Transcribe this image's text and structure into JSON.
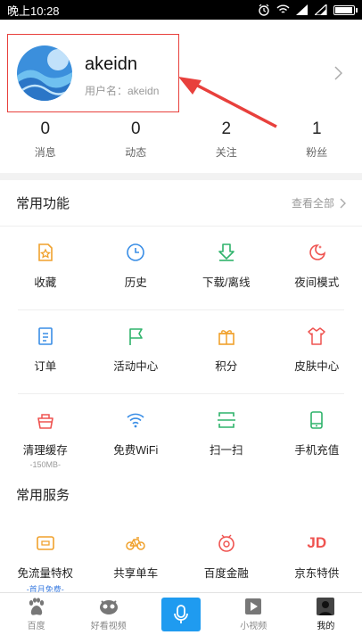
{
  "status_bar": {
    "time": "晚上10:28"
  },
  "profile": {
    "username": "akeidn",
    "user_id_line": "用户名：akeidn",
    "stats": [
      {
        "value": "0",
        "label": "消息"
      },
      {
        "value": "0",
        "label": "动态"
      },
      {
        "value": "2",
        "label": "关注"
      },
      {
        "value": "1",
        "label": "粉丝"
      }
    ]
  },
  "functions": {
    "title": "常用功能",
    "see_all": "查看全部",
    "items": [
      {
        "label": "收藏",
        "icon": "star-doc-icon",
        "color": "#f0a12c"
      },
      {
        "label": "历史",
        "icon": "clock-icon",
        "color": "#3a8ee6"
      },
      {
        "label": "下载/离线",
        "icon": "download-icon",
        "color": "#2fb36b"
      },
      {
        "label": "夜间模式",
        "icon": "moon-icon",
        "color": "#ef5350"
      },
      {
        "label": "订单",
        "icon": "order-icon",
        "color": "#3a8ee6"
      },
      {
        "label": "活动中心",
        "icon": "flag-icon",
        "color": "#2fb36b"
      },
      {
        "label": "积分",
        "icon": "gift-icon",
        "color": "#f0a12c"
      },
      {
        "label": "皮肤中心",
        "icon": "shirt-icon",
        "color": "#ef5350"
      },
      {
        "label": "清理缓存",
        "icon": "basket-icon",
        "color": "#ef5350",
        "sub": "-150MB-"
      },
      {
        "label": "免费WiFi",
        "icon": "wifi-icon",
        "color": "#3a8ee6"
      },
      {
        "label": "扫一扫",
        "icon": "scan-icon",
        "color": "#2fb36b"
      },
      {
        "label": "手机充值",
        "icon": "phone-icon",
        "color": "#2fb36b"
      }
    ]
  },
  "services": {
    "title": "常用服务",
    "items": [
      {
        "label": "免流量特权",
        "icon": "data-card-icon",
        "color": "#f0a12c",
        "sub": "-首月免费-"
      },
      {
        "label": "共享单车",
        "icon": "bike-icon",
        "color": "#f0a12c"
      },
      {
        "label": "百度金融",
        "icon": "finance-icon",
        "color": "#ef5350"
      },
      {
        "label": "京东特供",
        "icon": "jd-icon",
        "color": "#ef5350",
        "mark": "JD"
      }
    ]
  },
  "tab_bar": {
    "items": [
      {
        "label": "百度",
        "icon": "baidu-paw-icon"
      },
      {
        "label": "好看视频",
        "icon": "video-face-icon"
      },
      {
        "label": "",
        "icon": "mic-icon"
      },
      {
        "label": "小视频",
        "icon": "play-icon"
      },
      {
        "label": "我的",
        "icon": "user-avatar-icon",
        "active": true
      }
    ]
  },
  "colors": {
    "accent": "#1f9bf0",
    "annotation": "#e8403c"
  }
}
